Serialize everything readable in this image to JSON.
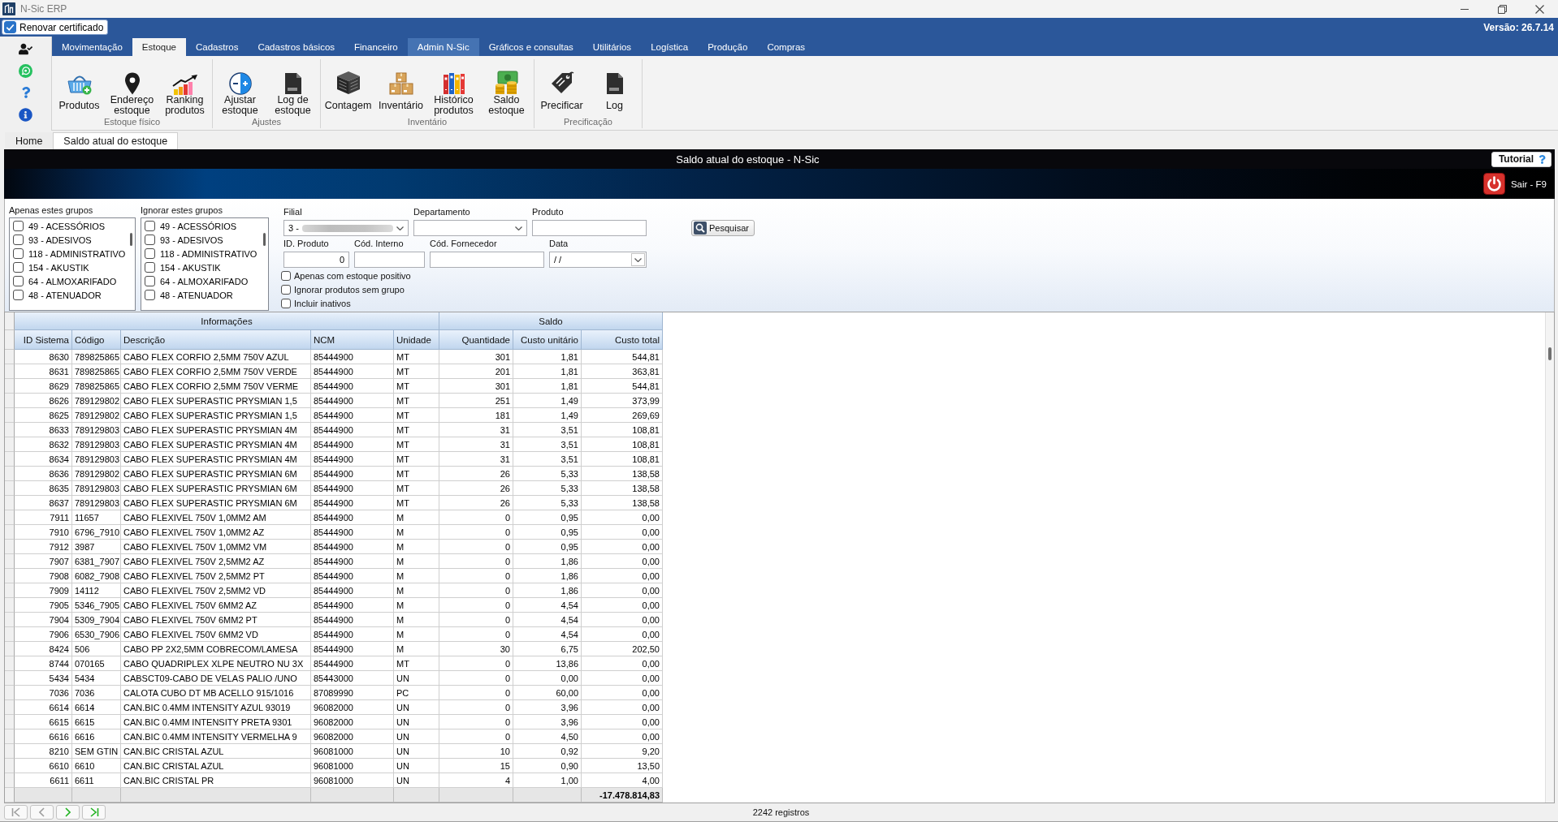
{
  "window": {
    "title": "N-Sic ERP"
  },
  "top_bar": {
    "certificate_option": {
      "label": "Renovar certificado",
      "checked": true
    },
    "version": "Versão: 26.7.14"
  },
  "ribbon": {
    "tabs": [
      {
        "label": "Movimentação",
        "selected": false,
        "highlighted": false
      },
      {
        "label": "Estoque",
        "selected": true,
        "highlighted": false
      },
      {
        "label": "Cadastros",
        "selected": false,
        "highlighted": false
      },
      {
        "label": "Cadastros básicos",
        "selected": false,
        "highlighted": false
      },
      {
        "label": "Financeiro",
        "selected": false,
        "highlighted": false
      },
      {
        "label": "Admin N-Sic",
        "selected": false,
        "highlighted": true
      },
      {
        "label": "Gráficos e consultas",
        "selected": false,
        "highlighted": false
      },
      {
        "label": "Utilitários",
        "selected": false,
        "highlighted": false
      },
      {
        "label": "Logística",
        "selected": false,
        "highlighted": false
      },
      {
        "label": "Produção",
        "selected": false,
        "highlighted": false
      },
      {
        "label": "Compras",
        "selected": false,
        "highlighted": false
      }
    ],
    "groups": [
      {
        "label": "Estoque físico",
        "items": [
          {
            "label": "Produtos",
            "kind": "basket"
          },
          {
            "label": "Endereço estoque",
            "kind": "pin"
          },
          {
            "label": "Ranking produtos",
            "kind": "ranking"
          }
        ]
      },
      {
        "label": "Ajustes",
        "items": [
          {
            "label": "Ajustar estoque",
            "kind": "adjust"
          },
          {
            "label": "Log de estoque",
            "kind": "logfile"
          }
        ]
      },
      {
        "label": "Inventário",
        "items": [
          {
            "label": "Contagem",
            "kind": "building"
          },
          {
            "label": "Inventário",
            "kind": "boxes"
          },
          {
            "label": "Histórico produtos",
            "kind": "binders"
          },
          {
            "label": "Saldo estoque",
            "kind": "money"
          }
        ]
      },
      {
        "label": "Precificação",
        "items": [
          {
            "label": "Precificar",
            "kind": "pricetag"
          },
          {
            "label": "Log",
            "kind": "logfile"
          }
        ]
      }
    ]
  },
  "document_tabs": [
    {
      "label": "Home",
      "selected": false
    },
    {
      "label": "Saldo atual do estoque",
      "selected": true
    }
  ],
  "page_header": {
    "title": "Saldo atual do estoque - N-Sic",
    "tutorial_button": "Tutorial",
    "exit_button": "Sair - F9"
  },
  "filters": {
    "group_lists": [
      {
        "label": "Apenas estes grupos",
        "items": [
          {
            "label": "49 - ACESSÓRIOS",
            "checked": false
          },
          {
            "label": "93 - ADESIVOS",
            "checked": false
          },
          {
            "label": "118 - ADMINISTRATIVO",
            "checked": false
          },
          {
            "label": "154 - AKUSTIK",
            "checked": false
          },
          {
            "label": "64 - ALMOXARIFADO",
            "checked": false
          },
          {
            "label": "48 - ATENUADOR",
            "checked": false
          }
        ]
      },
      {
        "label": "Ignorar estes grupos",
        "items": [
          {
            "label": "49 - ACESSÓRIOS",
            "checked": false
          },
          {
            "label": "93 - ADESIVOS",
            "checked": false
          },
          {
            "label": "118 - ADMINISTRATIVO",
            "checked": false
          },
          {
            "label": "154 - AKUSTIK",
            "checked": false
          },
          {
            "label": "64 - ALMOXARIFADO",
            "checked": false
          },
          {
            "label": "48 - ATENUADOR",
            "checked": false
          }
        ]
      }
    ],
    "field_rows": [
      [
        {
          "label": "Filial",
          "kind": "select",
          "value": "3 -",
          "redacted": true
        },
        {
          "label": "Departamento",
          "kind": "select"
        },
        {
          "label": "Produto",
          "kind": "text"
        }
      ],
      [
        {
          "label": "ID. Produto",
          "kind": "number",
          "value": "0"
        },
        {
          "label": "Cód. Interno",
          "kind": "text"
        },
        {
          "label": "Cód. Fornecedor",
          "kind": "text"
        },
        {
          "label": "Data",
          "kind": "date",
          "value": "/ /"
        }
      ]
    ],
    "search_button": "Pesquisar",
    "options": [
      {
        "label": "Apenas com estoque positivo",
        "checked": false
      },
      {
        "label": "Ignorar produtos sem grupo",
        "checked": false
      },
      {
        "label": "Incluir inativos",
        "checked": false
      }
    ]
  },
  "table": {
    "column_groups": [
      {
        "label": "Informações",
        "columns": [
          {
            "label": "ID Sistema",
            "kind": "number"
          },
          {
            "label": "Código",
            "kind": "text"
          },
          {
            "label": "Descrição",
            "kind": "text"
          },
          {
            "label": "NCM",
            "kind": "text"
          },
          {
            "label": "Unidade",
            "kind": "text"
          }
        ]
      },
      {
        "label": "Saldo",
        "columns": [
          {
            "label": "Quantidade",
            "kind": "number"
          },
          {
            "label": "Custo unitário",
            "kind": "number"
          },
          {
            "label": "Custo total",
            "kind": "number"
          }
        ]
      }
    ],
    "rows": [
      [
        "8630",
        "789825865",
        "CABO FLEX CORFIO 2,5MM 750V AZUL",
        "85444900",
        "MT",
        "301",
        "1,81",
        "544,81"
      ],
      [
        "8631",
        "789825865",
        "CABO FLEX CORFIO 2,5MM 750V VERDE",
        "85444900",
        "MT",
        "201",
        "1,81",
        "363,81"
      ],
      [
        "8629",
        "789825865",
        "CABO FLEX CORFIO 2,5MM 750V VERME",
        "85444900",
        "MT",
        "301",
        "1,81",
        "544,81"
      ],
      [
        "8626",
        "789129802",
        "CABO FLEX SUPERASTIC PRYSMIAN 1,5",
        "85444900",
        "MT",
        "251",
        "1,49",
        "373,99"
      ],
      [
        "8625",
        "789129802",
        "CABO FLEX SUPERASTIC PRYSMIAN 1,5",
        "85444900",
        "MT",
        "181",
        "1,49",
        "269,69"
      ],
      [
        "8633",
        "789129803",
        "CABO FLEX SUPERASTIC PRYSMIAN 4M",
        "85444900",
        "MT",
        "31",
        "3,51",
        "108,81"
      ],
      [
        "8632",
        "789129803",
        "CABO FLEX SUPERASTIC PRYSMIAN 4M",
        "85444900",
        "MT",
        "31",
        "3,51",
        "108,81"
      ],
      [
        "8634",
        "789129803",
        "CABO FLEX SUPERASTIC PRYSMIAN 4M",
        "85444900",
        "MT",
        "31",
        "3,51",
        "108,81"
      ],
      [
        "8636",
        "789129802",
        "CABO FLEX SUPERASTIC PRYSMIAN 6M",
        "85444900",
        "MT",
        "26",
        "5,33",
        "138,58"
      ],
      [
        "8635",
        "789129803",
        "CABO FLEX SUPERASTIC PRYSMIAN 6M",
        "85444900",
        "MT",
        "26",
        "5,33",
        "138,58"
      ],
      [
        "8637",
        "789129803",
        "CABO FLEX SUPERASTIC PRYSMIAN 6M",
        "85444900",
        "MT",
        "26",
        "5,33",
        "138,58"
      ],
      [
        "7911",
        "11657",
        "CABO FLEXIVEL 750V 1,0MM2 AM",
        "85444900",
        "M",
        "0",
        "0,95",
        "0,00"
      ],
      [
        "7910",
        "6796_7910",
        "CABO FLEXIVEL 750V 1,0MM2 AZ",
        "85444900",
        "M",
        "0",
        "0,95",
        "0,00"
      ],
      [
        "7912",
        "3987",
        "CABO FLEXIVEL 750V 1,0MM2 VM",
        "85444900",
        "M",
        "0",
        "0,95",
        "0,00"
      ],
      [
        "7907",
        "6381_7907",
        "CABO FLEXIVEL 750V 2,5MM2 AZ",
        "85444900",
        "M",
        "0",
        "1,86",
        "0,00"
      ],
      [
        "7908",
        "6082_7908",
        "CABO FLEXIVEL 750V 2,5MM2 PT",
        "85444900",
        "M",
        "0",
        "1,86",
        "0,00"
      ],
      [
        "7909",
        "14112",
        "CABO FLEXIVEL 750V 2,5MM2 VD",
        "85444900",
        "M",
        "0",
        "1,86",
        "0,00"
      ],
      [
        "7905",
        "5346_7905",
        "CABO FLEXIVEL 750V 6MM2 AZ",
        "85444900",
        "M",
        "0",
        "4,54",
        "0,00"
      ],
      [
        "7904",
        "5309_7904",
        "CABO FLEXIVEL 750V 6MM2 PT",
        "85444900",
        "M",
        "0",
        "4,54",
        "0,00"
      ],
      [
        "7906",
        "6530_7906",
        "CABO FLEXIVEL 750V 6MM2 VD",
        "85444900",
        "M",
        "0",
        "4,54",
        "0,00"
      ],
      [
        "8424",
        "506",
        "CABO PP 2X2,5MM COBRECOM/LAMESA",
        "85444900",
        "M",
        "30",
        "6,75",
        "202,50"
      ],
      [
        "8744",
        "070165",
        "CABO QUADRIPLEX XLPE NEUTRO NU 3X",
        "85444900",
        "MT",
        "0",
        "13,86",
        "0,00"
      ],
      [
        "5434",
        "5434",
        "CABSCT09-CABO DE VELAS PALIO /UNO",
        "85443000",
        "UN",
        "0",
        "0,00",
        "0,00"
      ],
      [
        "7036",
        "7036",
        "CALOTA CUBO DT MB ACELLO 915/1016",
        "87089990",
        "PC",
        "0",
        "60,00",
        "0,00"
      ],
      [
        "6614",
        "6614",
        "CAN.BIC 0.4MM INTENSITY AZUL 93019",
        "96082000",
        "UN",
        "0",
        "3,96",
        "0,00"
      ],
      [
        "6615",
        "6615",
        "CAN.BIC 0.4MM INTENSITY PRETA 9301",
        "96082000",
        "UN",
        "0",
        "3,96",
        "0,00"
      ],
      [
        "6616",
        "6616",
        "CAN.BIC 0.4MM INTENSITY VERMELHA 9",
        "96082000",
        "UN",
        "0",
        "4,50",
        "0,00"
      ],
      [
        "8210",
        "SEM GTIN",
        "CAN.BIC CRISTAL AZUL",
        "96081000",
        "UN",
        "10",
        "0,92",
        "9,20"
      ],
      [
        "6610",
        "6610",
        "CAN.BIC CRISTAL AZUL",
        "96081000",
        "UN",
        "15",
        "0,90",
        "13,50"
      ],
      [
        "6611",
        "6611",
        "CAN.BIC CRISTAL PR",
        "96081000",
        "UN",
        "4",
        "1,00",
        "4,00"
      ]
    ],
    "total": "-17.478.814,83"
  },
  "pagination": {
    "buttons": [
      {
        "kind": "first",
        "disabled": true
      },
      {
        "kind": "previous",
        "disabled": true
      },
      {
        "kind": "next",
        "disabled": false
      },
      {
        "kind": "last",
        "disabled": false
      }
    ],
    "record_count": "2242 registros"
  }
}
